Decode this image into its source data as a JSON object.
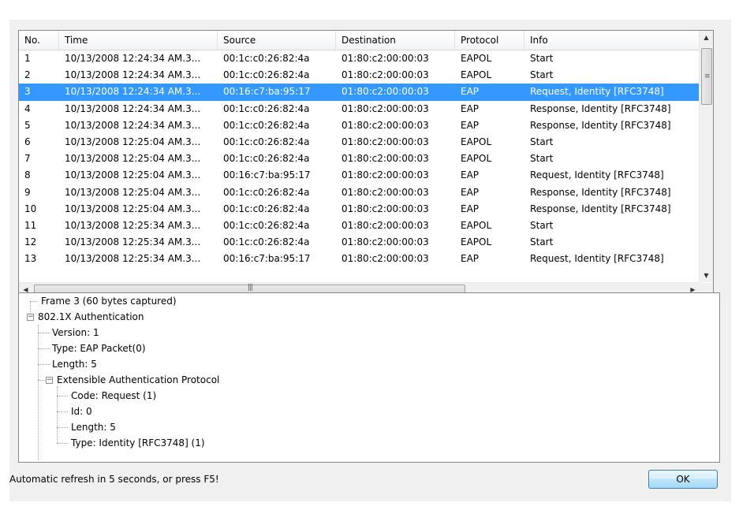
{
  "packet_list": {
    "columns": [
      "No.",
      "Time",
      "Source",
      "Destination",
      "Protocol",
      "Info"
    ],
    "rows": [
      {
        "no": "1",
        "time": "10/13/2008 12:24:34 AM.3...",
        "src": "00:1c:c0:26:82:4a",
        "dst": "01:80:c2:00:00:03",
        "proto": "EAPOL",
        "info": "Start"
      },
      {
        "no": "2",
        "time": "10/13/2008 12:24:34 AM.3...",
        "src": "00:1c:c0:26:82:4a",
        "dst": "01:80:c2:00:00:03",
        "proto": "EAPOL",
        "info": "Start"
      },
      {
        "no": "3",
        "time": "10/13/2008 12:24:34 AM.3...",
        "src": "00:16:c7:ba:95:17",
        "dst": "01:80:c2:00:00:03",
        "proto": "EAP",
        "info": "Request, Identity [RFC3748]"
      },
      {
        "no": "4",
        "time": "10/13/2008 12:24:34 AM.3...",
        "src": "00:1c:c0:26:82:4a",
        "dst": "01:80:c2:00:00:03",
        "proto": "EAP",
        "info": "Response, Identity [RFC3748]"
      },
      {
        "no": "5",
        "time": "10/13/2008 12:24:34 AM.3...",
        "src": "00:1c:c0:26:82:4a",
        "dst": "01:80:c2:00:00:03",
        "proto": "EAP",
        "info": "Response, Identity [RFC3748]"
      },
      {
        "no": "6",
        "time": "10/13/2008 12:25:04 AM.3...",
        "src": "00:1c:c0:26:82:4a",
        "dst": "01:80:c2:00:00:03",
        "proto": "EAPOL",
        "info": "Start"
      },
      {
        "no": "7",
        "time": "10/13/2008 12:25:04 AM.3...",
        "src": "00:1c:c0:26:82:4a",
        "dst": "01:80:c2:00:00:03",
        "proto": "EAPOL",
        "info": "Start"
      },
      {
        "no": "8",
        "time": "10/13/2008 12:25:04 AM.3...",
        "src": "00:16:c7:ba:95:17",
        "dst": "01:80:c2:00:00:03",
        "proto": "EAP",
        "info": "Request, Identity [RFC3748]"
      },
      {
        "no": "9",
        "time": "10/13/2008 12:25:04 AM.3...",
        "src": "00:1c:c0:26:82:4a",
        "dst": "01:80:c2:00:00:03",
        "proto": "EAP",
        "info": "Response, Identity [RFC3748]"
      },
      {
        "no": "10",
        "time": "10/13/2008 12:25:04 AM.3...",
        "src": "00:1c:c0:26:82:4a",
        "dst": "01:80:c2:00:00:03",
        "proto": "EAP",
        "info": "Response, Identity [RFC3748]"
      },
      {
        "no": "11",
        "time": "10/13/2008 12:25:34 AM.3...",
        "src": "00:1c:c0:26:82:4a",
        "dst": "01:80:c2:00:00:03",
        "proto": "EAPOL",
        "info": "Start"
      },
      {
        "no": "12",
        "time": "10/13/2008 12:25:34 AM.3...",
        "src": "00:1c:c0:26:82:4a",
        "dst": "01:80:c2:00:00:03",
        "proto": "EAPOL",
        "info": "Start"
      },
      {
        "no": "13",
        "time": "10/13/2008 12:25:34 AM.3...",
        "src": "00:16:c7:ba:95:17",
        "dst": "01:80:c2:00:00:03",
        "proto": "EAP",
        "info": "Request, Identity [RFC3748]"
      }
    ],
    "selected_index": 2,
    "selection_color": "#3399ff"
  },
  "scrollbars": {
    "up_icon": "chevron-up-icon",
    "down_icon": "chevron-down-icon",
    "left_icon": "chevron-left-icon",
    "right_icon": "chevron-right-icon"
  },
  "detail_tree": {
    "frame": "Frame 3 (60 bytes captured)",
    "auth": "802.1X Authentication",
    "version": "Version: 1",
    "type": "Type: EAP Packet(0)",
    "length": "Length: 5",
    "eap": "Extensible Authentication Protocol",
    "code": "Code: Request (1)",
    "id": "Id: 0",
    "eap_length": "Length: 5",
    "eap_type": "Type: Identity [RFC3748] (1)",
    "expanded_icon": "minus-box-icon"
  },
  "footer": {
    "status": "Automatic refresh in 5 seconds, or press F5!",
    "ok_label": "OK"
  }
}
